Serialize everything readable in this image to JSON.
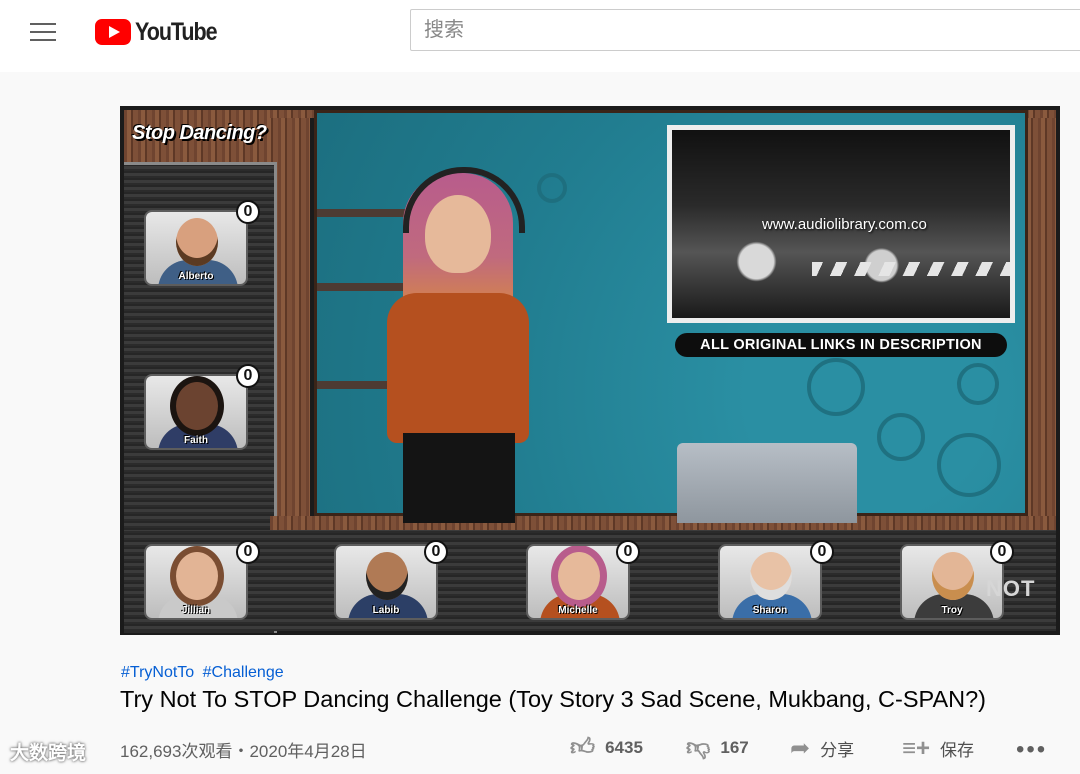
{
  "header": {
    "logo_text": "YouTube",
    "search_placeholder": "搜索"
  },
  "video": {
    "show_title": "Stop Dancing?",
    "inset_url": "www.audiolibrary.com.co",
    "links_banner": "ALL ORIGINAL LINKS IN DESCRIPTION",
    "corner_mark": "NOT",
    "contestants": [
      {
        "name": "Alberto",
        "score": "0"
      },
      {
        "name": "Faith",
        "score": "0"
      },
      {
        "name": "Jillian",
        "score": "0"
      },
      {
        "name": "Labib",
        "score": "0"
      },
      {
        "name": "Michelle",
        "score": "0"
      },
      {
        "name": "Sharon",
        "score": "0"
      },
      {
        "name": "Troy",
        "score": "0"
      }
    ]
  },
  "info": {
    "hashtags": [
      "#TryNotTo",
      "#Challenge"
    ],
    "title": "Try Not To STOP Dancing Challenge (Toy Story 3 Sad Scene, Mukbang, C-SPAN?)",
    "views_date": "162,693次观看・2020年4月28日"
  },
  "actions": {
    "likes": "6435",
    "dislikes": "167",
    "share_label": "分享",
    "save_label": "保存",
    "more_label": "•••"
  },
  "overlay_watermark": "大数跨境",
  "colors": {
    "brand_red": "#ff0000",
    "link_blue": "#065fd4",
    "text_primary": "#030303",
    "text_secondary": "#606060"
  }
}
